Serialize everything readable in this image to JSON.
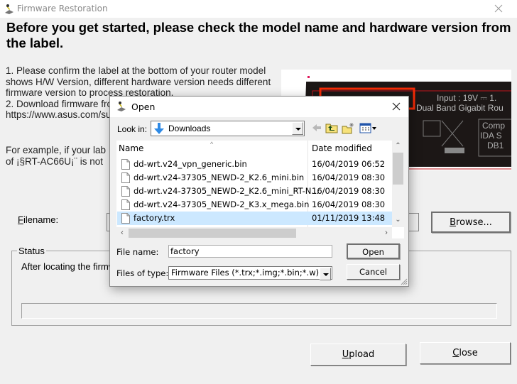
{
  "window": {
    "title": "Firmware Restoration",
    "app_icon": "firmware-restoration-icon",
    "close_icon": "close-icon"
  },
  "main": {
    "heading": "Before you get started, please check the model name and hardware version from the label.",
    "instructions": [
      "1. Please confirm the label at the bottom of your router model shows H/W Version, different hardware version needs different firmware version to process restoration.",
      "2. Download firmware from",
      "https://www.asus.com/su"
    ],
    "example": [
      "For example, if your lab",
      "of ¡§RT-AC66U¡¨ is not"
    ],
    "label_image": {
      "texts": [
        "Input : 19V ⎓ 1.",
        "Dual Band Gigabit Rou",
        "Comp",
        "IDA S",
        "DB1"
      ]
    },
    "filename_label": "Filename:",
    "filename_value": "",
    "browse_label": "Browse...",
    "status_label": "Status",
    "status_text": "After locating the firmw",
    "progress_percent": 0,
    "upload_label": "Upload",
    "close_label": "Close"
  },
  "dialog": {
    "title": "Open",
    "look_in_label": "Look in:",
    "look_in_value": "Downloads",
    "toolbar": [
      "back-arrow-icon",
      "up-folder-icon",
      "new-folder-icon",
      "view-menu-icon"
    ],
    "columns": {
      "name": "Name",
      "date": "Date modified"
    },
    "files": [
      {
        "name": "dd-wrt.v24_vpn_generic.bin",
        "date": "16/04/2019 06:52",
        "selected": false
      },
      {
        "name": "dd-wrt.v24-37305_NEWD-2_K2.6_mini.bin",
        "date": "16/04/2019 08:30",
        "selected": false
      },
      {
        "name": "dd-wrt.v24-37305_NEWD-2_K2.6_mini_RT-N...",
        "date": "16/04/2019 08:30",
        "selected": false
      },
      {
        "name": "dd-wrt.v24-37305_NEWD-2_K3.x_mega.bin",
        "date": "16/04/2019 08:30",
        "selected": false
      },
      {
        "name": "factory.trx",
        "date": "01/11/2019 13:48",
        "selected": true
      }
    ],
    "file_name_label": "File name:",
    "file_name_value": "factory",
    "file_type_label": "Files of type:",
    "file_type_value": "Firmware Files (*.trx;*.img;*.bin;*.w)",
    "open_label": "Open",
    "cancel_label": "Cancel"
  }
}
